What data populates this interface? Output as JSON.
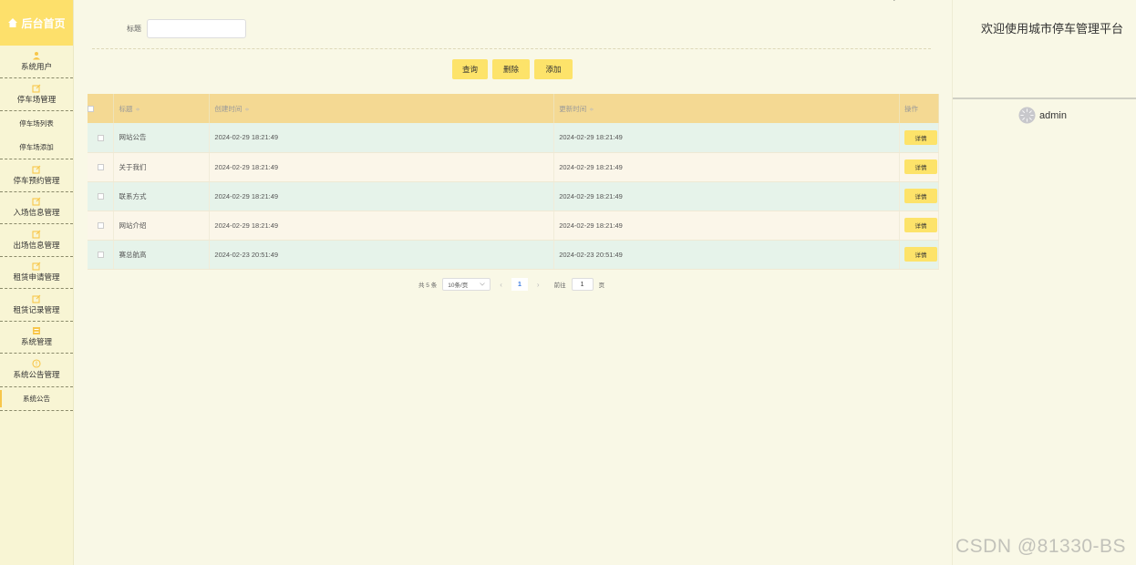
{
  "sidebar": {
    "brand": "后台首页",
    "groups": [
      {
        "label": "系统用户"
      },
      {
        "label": "停车场管理"
      },
      {
        "label": "停车预约管理"
      },
      {
        "label": "入场信息管理"
      },
      {
        "label": "出场信息管理"
      },
      {
        "label": "租赁申请管理"
      },
      {
        "label": "租赁记录管理"
      },
      {
        "label": "系统管理"
      },
      {
        "label": "系统公告管理"
      }
    ],
    "sub_items": {
      "parking_list": "停车场列表",
      "parking_add": "停车场添加",
      "notice": "系统公告"
    }
  },
  "search": {
    "label": "标题",
    "value": ""
  },
  "buttons": {
    "query": "查询",
    "delete": "删除",
    "add": "添加"
  },
  "table": {
    "headers": {
      "title": "标题",
      "created": "创建时间",
      "updated": "更新时间",
      "op": "操作"
    },
    "sort_glyph": "≑",
    "detail_label": "详情",
    "rows": [
      {
        "title": "网站公告",
        "created": "2024-02-29 18:21:49",
        "updated": "2024-02-29 18:21:49"
      },
      {
        "title": "关于我们",
        "created": "2024-02-29 18:21:49",
        "updated": "2024-02-29 18:21:49"
      },
      {
        "title": "联系方式",
        "created": "2024-02-29 18:21:49",
        "updated": "2024-02-29 18:21:49"
      },
      {
        "title": "网站介绍",
        "created": "2024-02-29 18:21:49",
        "updated": "2024-02-29 18:21:49"
      },
      {
        "title": "赛总航高",
        "created": "2024-02-23 20:51:49",
        "updated": "2024-02-23 20:51:49"
      }
    ]
  },
  "pagination": {
    "total": "共 5 条",
    "page_size": "10条/页",
    "prev": "‹",
    "current": "1",
    "next": "›",
    "goto_prefix": "前往",
    "goto_value": "1",
    "goto_suffix": "页"
  },
  "right_panel": {
    "welcome": "欢迎使用城市停车管理平台",
    "username": "admin"
  },
  "corner_glyph": "ʻ",
  "watermark": "CSDN @81330-BS",
  "colors": {
    "accent": "#fde36a",
    "header_bg": "#f4d993",
    "row_a": "#e6f3ea",
    "row_b": "#fbf6e9",
    "page_bg": "#f9f8e6"
  }
}
